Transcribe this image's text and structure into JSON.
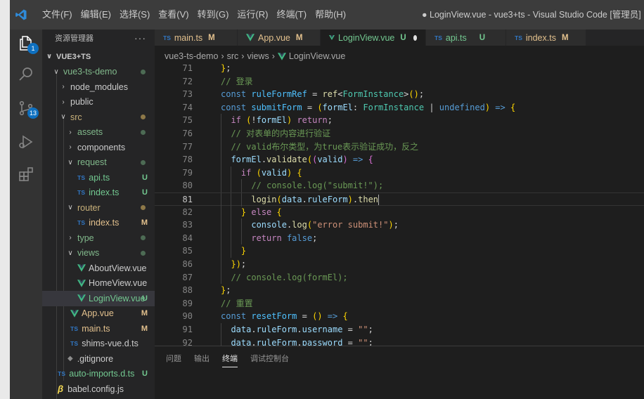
{
  "title_bar": {
    "menu": [
      "文件(F)",
      "编辑(E)",
      "选择(S)",
      "查看(V)",
      "转到(G)",
      "运行(R)",
      "终端(T)",
      "帮助(H)"
    ],
    "window_title": "● LoginView.vue - vue3+ts - Visual Studio Code [管理员]"
  },
  "activity_bar": {
    "explorer_badge": "1",
    "source_control_badge": "13"
  },
  "sidebar": {
    "header": "资源管理器",
    "more": "···",
    "root": "VUE3+TS",
    "items": [
      {
        "label": "vue3-ts-demo",
        "status": "dot-green"
      },
      {
        "label": "node_modules"
      },
      {
        "label": "public"
      },
      {
        "label": "src",
        "status": "dot-yellow"
      },
      {
        "label": "assets",
        "status": "dot-green"
      },
      {
        "label": "components"
      },
      {
        "label": "request",
        "status": "dot-green"
      },
      {
        "label": "api.ts",
        "status": "U",
        "icon": "TS"
      },
      {
        "label": "index.ts",
        "status": "U",
        "icon": "TS"
      },
      {
        "label": "router",
        "status": "dot-yellow"
      },
      {
        "label": "index.ts",
        "status": "M",
        "icon": "TS"
      },
      {
        "label": "type",
        "status": "dot-green"
      },
      {
        "label": "views",
        "status": "dot-green"
      },
      {
        "label": "AboutView.vue"
      },
      {
        "label": "HomeView.vue"
      },
      {
        "label": "LoginView.vue",
        "status": "U"
      },
      {
        "label": "App.vue",
        "status": "M"
      },
      {
        "label": "main.ts",
        "status": "M",
        "icon": "TS"
      },
      {
        "label": "shims-vue.d.ts",
        "icon": "TS"
      },
      {
        "label": ".gitignore"
      },
      {
        "label": "auto-imports.d.ts",
        "status": "U",
        "icon": "TS"
      },
      {
        "label": "babel.config.js"
      }
    ]
  },
  "tabs": [
    {
      "label": "main.ts",
      "status": "M",
      "icon": "TS"
    },
    {
      "label": "App.vue",
      "status": "M"
    },
    {
      "label": "LoginView.vue",
      "status": "U"
    },
    {
      "label": "api.ts",
      "status": "U",
      "icon": "TS"
    },
    {
      "label": "index.ts",
      "status": "M",
      "icon": "TS"
    }
  ],
  "breadcrumb": [
    "vue3-ts-demo",
    "src",
    "views",
    "LoginView.vue"
  ],
  "editor": {
    "line_numbers": [
      "71",
      "72",
      "73",
      "74",
      "75",
      "76",
      "77",
      "78",
      "79",
      "80",
      "81",
      "82",
      "83",
      "84",
      "85",
      "86",
      "87",
      "88",
      "89",
      "90",
      "91",
      "92"
    ],
    "current_line": "81",
    "lines": [
      "};",
      "// 登录",
      "const ruleFormRef = ref<FormInstance>();",
      "const submitForm = (formEl: FormInstance | undefined) => {",
      "  if (!formEl) return;",
      "  // 对表单的内容进行验证",
      "  // valid布尔类型，为true表示验证成功，反之",
      "  formEl.validate((valid) => {",
      "    if (valid) {",
      "      // console.log(\"submit!\");",
      "      login(data.ruleForm).then",
      "    } else {",
      "      console.log(\"error submit!\");",
      "      return false;",
      "    }",
      "  });",
      "  // console.log(formEl);",
      "};",
      "// 重置",
      "const resetForm = () => {",
      "  data.ruleForm.username = \"\";",
      "  data.ruleForm.password = \"\";"
    ]
  },
  "panel": {
    "tabs": [
      "问题",
      "输出",
      "终端",
      "调试控制台"
    ],
    "active": "终端"
  },
  "colors": {
    "activity_bar": "#333333",
    "sidebar": "#252526",
    "editor": "#1e1e1e",
    "untracked": "#73c991",
    "modified": "#e2c08d",
    "badge": "#0e70c0"
  }
}
